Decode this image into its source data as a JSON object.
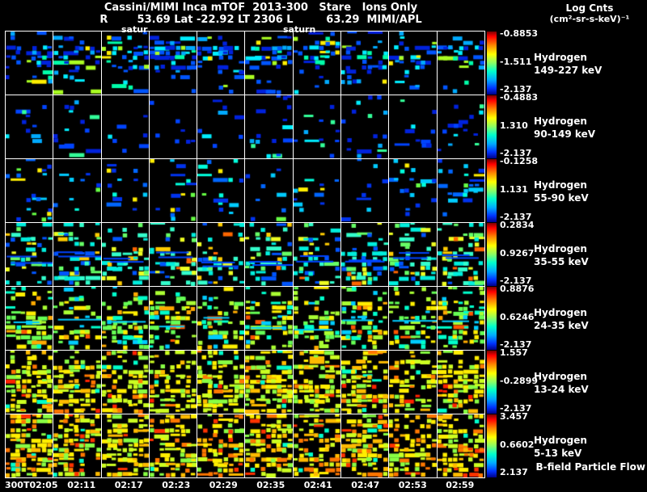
{
  "header": {
    "title_line1": "Cassini/MIMI Inca mTOF  2013-300   Stare   Ions Only",
    "title_line2": "R        53.69 Lat -22.92 LT 2306 L         63.29  MIMI/APL",
    "colorbar_title": "Log Cnts",
    "colorbar_units": "(cm²-sr-s-keV)⁻¹"
  },
  "annotations": {
    "saturn_left": "satur",
    "saturn_right": "saturn",
    "bfield_flow": "B-field Particle Flow"
  },
  "chart_data": {
    "type": "heatmap",
    "title": "Cassini/MIMI Inca mTOF 2013-300 Stare Ions Only",
    "x_tick_labels": [
      "300T02:05",
      "02:11",
      "02:17",
      "02:23",
      "02:29",
      "02:35",
      "02:41",
      "02:47",
      "02:53",
      "02:59"
    ],
    "n_panel_columns": 10,
    "colorbar_gradient": [
      [
        "#7a0000",
        0
      ],
      [
        "#ff0000",
        8
      ],
      [
        "#ff8800",
        22
      ],
      [
        "#ffff00",
        36
      ],
      [
        "#88ff66",
        50
      ],
      [
        "#00ffcc",
        63
      ],
      [
        "#00aaff",
        77
      ],
      [
        "#0033ff",
        90
      ],
      [
        "#000088",
        100
      ]
    ],
    "rows": [
      {
        "species": "Hydrogen",
        "energy_band": "149-227 keV",
        "colorbar": {
          "top": "-0.8853",
          "mid": "-1.511",
          "bottom": "-2.137"
        },
        "render": {
          "density": 0.5,
          "profile": [
            0.3,
            1,
            0.7,
            0.35,
            0.15
          ],
          "palette": [
            [
              "#0022dd",
              0.28
            ],
            [
              "#0055ff",
              0.22
            ],
            [
              "#00aaff",
              0.15
            ],
            [
              "#00eeff",
              0.15
            ],
            [
              "#00ffaa",
              0.08
            ],
            [
              "#aaff22",
              0.07
            ],
            [
              "#ffee00",
              0.05
            ]
          ]
        }
      },
      {
        "species": "Hydrogen",
        "energy_band": "90-149 keV",
        "colorbar": {
          "top": "-0.4883",
          "mid": "1.310",
          "bottom": "-2.137"
        },
        "render": {
          "density": 0.16,
          "profile": [
            0.5,
            0.8,
            0.8,
            0.7,
            0.4
          ],
          "palette": [
            [
              "#0022dd",
              0.4
            ],
            [
              "#0044ff",
              0.25
            ],
            [
              "#00aaff",
              0.15
            ],
            [
              "#00eeff",
              0.12
            ],
            [
              "#33ff99",
              0.08
            ]
          ]
        }
      },
      {
        "species": "Hydrogen",
        "energy_band": "55-90 keV",
        "colorbar": {
          "top": "-0.1258",
          "mid": "1.131",
          "bottom": "-2.137"
        },
        "render": {
          "density": 0.2,
          "profile": [
            0.6,
            0.8,
            0.8,
            0.7,
            0.5
          ],
          "palette": [
            [
              "#0033ee",
              0.3
            ],
            [
              "#0066ff",
              0.2
            ],
            [
              "#00ccff",
              0.2
            ],
            [
              "#00ffdd",
              0.12
            ],
            [
              "#66ff44",
              0.1
            ],
            [
              "#ffee00",
              0.08
            ]
          ]
        }
      },
      {
        "species": "Hydrogen",
        "energy_band": "35-55 keV",
        "colorbar": {
          "top": "0.2834",
          "mid": "0.9267",
          "bottom": "-2.137"
        },
        "render": {
          "density": 0.42,
          "profile": [
            0.45,
            0.55,
            1,
            1,
            0.7
          ],
          "streaks": 2,
          "streak_color": "#0044ff",
          "palette": [
            [
              "#00eedd",
              0.3
            ],
            [
              "#33ffcc",
              0.2
            ],
            [
              "#0055ff",
              0.15
            ],
            [
              "#66ff66",
              0.12
            ],
            [
              "#eeff22",
              0.12
            ],
            [
              "#ffcc00",
              0.06
            ],
            [
              "#ff6600",
              0.05
            ]
          ]
        }
      },
      {
        "species": "Hydrogen",
        "energy_band": "24-35 keV",
        "colorbar": {
          "top": "0.8876",
          "mid": "0.6246",
          "bottom": "-2.137"
        },
        "render": {
          "density": 0.5,
          "profile": [
            0.5,
            0.8,
            1,
            1,
            0.7
          ],
          "streaks": 1,
          "streak_color": "#00ccff",
          "palette": [
            [
              "#66ff55",
              0.25
            ],
            [
              "#aaff33",
              0.22
            ],
            [
              "#00ffcc",
              0.18
            ],
            [
              "#ffee00",
              0.15
            ],
            [
              "#00ccff",
              0.08
            ],
            [
              "#ffaa00",
              0.07
            ],
            [
              "#ff5500",
              0.05
            ]
          ]
        }
      },
      {
        "species": "Hydrogen",
        "energy_band": "13-24 keV",
        "colorbar": {
          "top": "1.557",
          "mid": "-0.2899",
          "bottom": "-2.137"
        },
        "render": {
          "density": 0.62,
          "profile": [
            0.6,
            0.9,
            1,
            1,
            0.85
          ],
          "palette": [
            [
              "#ffee00",
              0.3
            ],
            [
              "#ccff22",
              0.25
            ],
            [
              "#88ff44",
              0.18
            ],
            [
              "#ffbb00",
              0.12
            ],
            [
              "#ff7700",
              0.08
            ],
            [
              "#00ffcc",
              0.04
            ],
            [
              "#ff2200",
              0.03
            ]
          ]
        }
      },
      {
        "species": "Hydrogen",
        "energy_band": "5-13 keV",
        "colorbar": {
          "top": "3.457",
          "mid": "0.6602",
          "bottom": "2.137"
        },
        "render": {
          "density": 0.62,
          "profile": [
            0.7,
            0.9,
            1,
            1,
            0.9
          ],
          "palette": [
            [
              "#ffee00",
              0.28
            ],
            [
              "#ffbb00",
              0.2
            ],
            [
              "#ccff22",
              0.18
            ],
            [
              "#88ff44",
              0.12
            ],
            [
              "#ff7700",
              0.12
            ],
            [
              "#ff3300",
              0.06
            ],
            [
              "#00ffcc",
              0.04
            ]
          ]
        }
      }
    ]
  }
}
